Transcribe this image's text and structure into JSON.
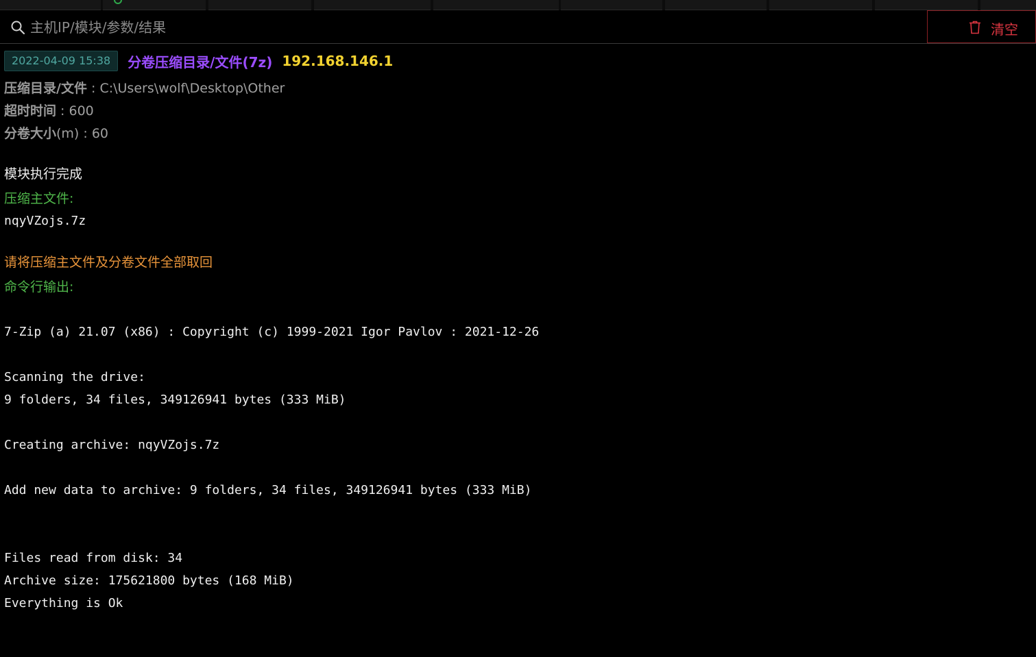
{
  "search": {
    "placeholder": "主机IP/模块/参数/结果",
    "value": ""
  },
  "clear_button": {
    "label": "清空"
  },
  "icons": {
    "search": "search-icon",
    "clear": "trash-icon"
  },
  "colors": {
    "module_title": "#9b4dff",
    "host_ip": "#f2d230",
    "timestamp": "#4fa7a0",
    "success_label": "#4fb64a",
    "warning": "#e8943a",
    "clear_button": "#d93540"
  },
  "entry": {
    "timestamp": "2022-04-09 15:38",
    "module": "分卷压缩目录/文件(7z)",
    "host": "192.168.146.1",
    "params": [
      {
        "key": "压缩目录/文件",
        "sep": " : ",
        "value": "C:\\Users\\wolf\\Desktop\\Other"
      },
      {
        "key": "超时时间",
        "sep": " : ",
        "value": "600"
      },
      {
        "key": "分卷大小",
        "key_suffix": "(m)",
        "sep": " : ",
        "value": "60"
      }
    ],
    "result": {
      "status": "模块执行完成",
      "main_file_label": "压缩主文件:",
      "main_file": "nqyVZojs.7z",
      "notice": "请将压缩主文件及分卷文件全部取回",
      "cmd_output_label": "命令行输出:",
      "cmd_output": [
        "7-Zip (a) 21.07 (x86) : Copyright (c) 1999-2021 Igor Pavlov : 2021-12-26",
        "Scanning the drive:",
        "9 folders, 34 files, 349126941 bytes (333 MiB)",
        "Creating archive: nqyVZojs.7z",
        "Add new data to archive: 9 folders, 34 files, 349126941 bytes (333 MiB)",
        "Files read from disk: 34",
        "Archive size: 175621800 bytes (168 MiB)",
        "Everything is Ok"
      ]
    }
  }
}
